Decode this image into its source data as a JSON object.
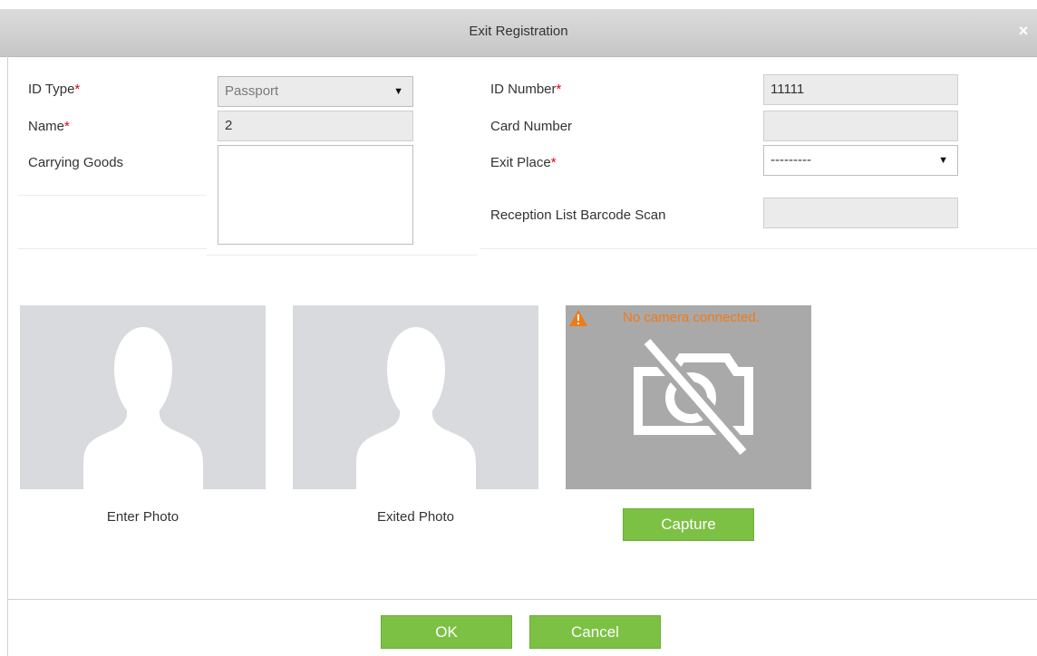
{
  "dialog": {
    "title": "Exit Registration",
    "close_label": "×"
  },
  "form": {
    "id_type": {
      "label": "ID Type",
      "required": "*",
      "value": "Passport"
    },
    "name": {
      "label": "Name",
      "required": "*",
      "value": "2"
    },
    "carrying_goods": {
      "label": "Carrying Goods",
      "value": ""
    },
    "id_number": {
      "label": "ID Number",
      "required": "*",
      "value": "11111"
    },
    "card_number": {
      "label": "Card Number",
      "value": ""
    },
    "exit_place": {
      "label": "Exit Place",
      "required": "*",
      "value": "---------"
    },
    "barcode_scan": {
      "label": "Reception List Barcode Scan",
      "value": ""
    }
  },
  "photos": {
    "enter_caption": "Enter Photo",
    "exited_caption": "Exited Photo",
    "camera_warning": "No camera connected.",
    "capture_label": "Capture"
  },
  "footer": {
    "ok_label": "OK",
    "cancel_label": "Cancel"
  },
  "colors": {
    "button_green": "#7cc144",
    "required_red": "#e60012",
    "warning_orange": "#f07a18",
    "titlebar_gray": "#d0d0d0"
  },
  "icons": {
    "close": "close-icon",
    "dropdown": "chevron-down-icon",
    "person_placeholder": "person-silhouette-icon",
    "warning": "warning-triangle-icon",
    "no_camera": "no-camera-icon"
  }
}
